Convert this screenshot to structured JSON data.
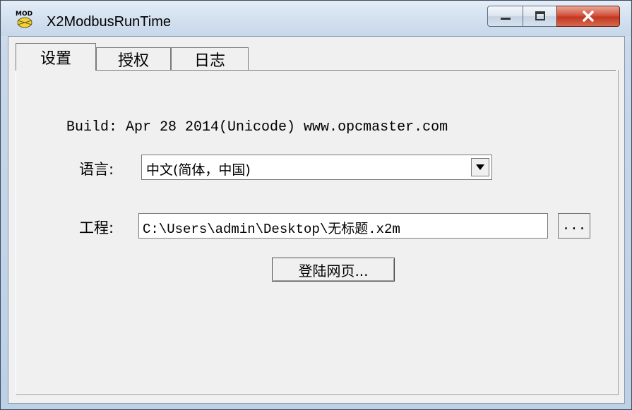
{
  "window": {
    "title": "X2ModbusRunTime",
    "icon": "mod-app-icon",
    "icon_text": "MOD",
    "controls": [
      "minimize-icon",
      "maximize-icon",
      "close-icon"
    ]
  },
  "tabs": [
    {
      "label": "设置",
      "active": true
    },
    {
      "label": "授权",
      "active": false
    },
    {
      "label": "日志",
      "active": false
    }
  ],
  "settings": {
    "build_info": "Build: Apr 28 2014(Unicode) www.opcmaster.com",
    "language_label": "语言:",
    "language_value": "中文(简体，中国)",
    "project_label": "工程:",
    "project_value": "C:\\Users\\admin\\Desktop\\无标题.x2m",
    "browse_label": "...",
    "login_button": "登陆网页..."
  },
  "colors": {
    "close_button": "#c2371f",
    "panel_bg": "#f0f0f0",
    "titlebar_bg": "#d5e2f0"
  }
}
